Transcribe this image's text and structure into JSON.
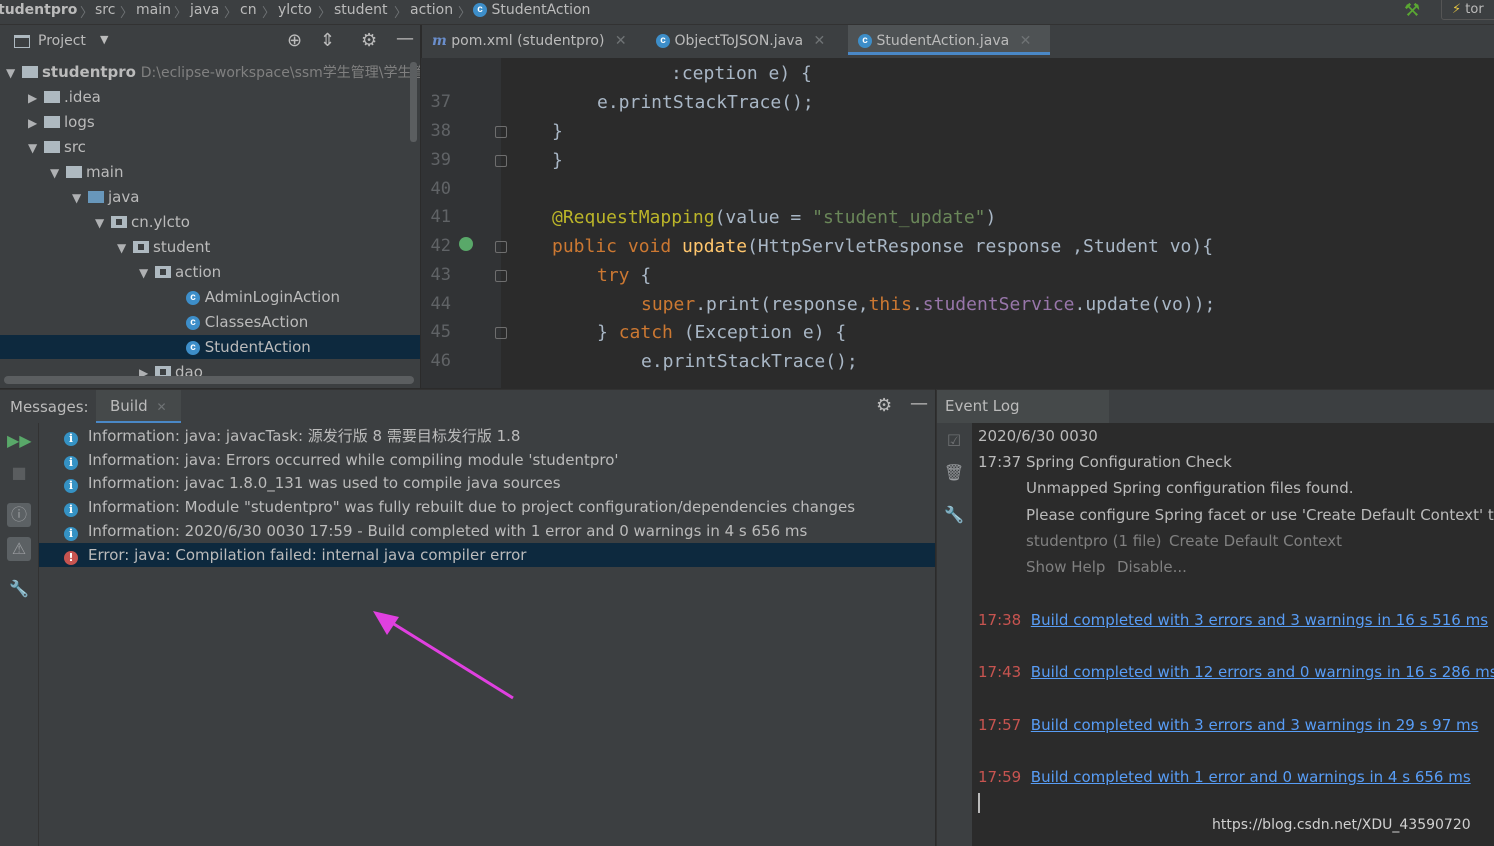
{
  "breadcrumb": {
    "items": [
      "tudentpro",
      "src",
      "main",
      "java",
      "cn",
      "ylcto",
      "student",
      "action"
    ],
    "current": "StudentAction",
    "run_config": "tor"
  },
  "project_panel": {
    "title": "Project",
    "root": {
      "name": "studentpro",
      "path": "D:\\eclipse-workspace\\ssm学生管理\\学生管理系统学生模块开发\\studentpro"
    },
    "nodes": [
      ".idea",
      "logs",
      "src",
      "main",
      "java",
      "cn.ylcto",
      "student",
      "action",
      "AdminLoginAction",
      "ClassesAction",
      "StudentAction",
      "dao"
    ]
  },
  "editor": {
    "tabs": [
      {
        "label": "pom.xml (studentpro)"
      },
      {
        "label": "ObjectToJSON.java"
      },
      {
        "label": "StudentAction.java",
        "active": true
      }
    ],
    "line_numbers": [
      "37",
      "38",
      "39",
      "40",
      "41",
      "42",
      "43",
      "44",
      "45",
      "46"
    ],
    "code": {
      "l36_tail": ":ception e) {",
      "l37": "e.printStackTrace();",
      "l38": "}",
      "l39": "}",
      "l41_anno": "@RequestMapping",
      "l41_open": "(",
      "l41_attr": "value",
      "l41_eq": " = ",
      "l41_str": "\"student_update\"",
      "l41_close": ")",
      "l42_kw": "public void ",
      "l42_fn": "update",
      "l42_rest": "(HttpServletResponse response ,Student vo){",
      "l43_kw": "try",
      "l43_rest": " {",
      "l44_kw1": "super",
      "l44_a": ".print(response,",
      "l44_kw2": "this",
      "l44_b": ".",
      "l44_field": "studentService",
      "l44_c": ".update(vo));",
      "l45_a": "} ",
      "l45_kw": "catch",
      "l45_b": " (Exception e) {",
      "l46": "e.printStackTrace();"
    }
  },
  "messages": {
    "label": "Messages:",
    "tab": "Build",
    "items": [
      {
        "type": "info",
        "text": "Information: java: javacTask: 源发行版 8 需要目标发行版 1.8"
      },
      {
        "type": "info",
        "text": "Information: java: Errors occurred while compiling module 'studentpro'"
      },
      {
        "type": "info",
        "text": "Information: javac 1.8.0_131 was used to compile java sources"
      },
      {
        "type": "info",
        "text": "Information: Module \"studentpro\" was fully rebuilt due to project configuration/dependencies changes"
      },
      {
        "type": "info",
        "text": "Information: 2020/6/30 0030 17:59 - Build completed with 1 error and 0 warnings in 4 s 656 ms"
      },
      {
        "type": "error",
        "text": "Error: java: Compilation failed: internal java compiler error"
      }
    ]
  },
  "event_log": {
    "title": "Event Log",
    "date": "2020/6/30 0030",
    "first": {
      "time": "17:37",
      "title": "Spring Configuration Check",
      "line1": "Unmapped Spring configuration files found.",
      "line2": "Please configure Spring facet or use 'Create Default Context' to a",
      "action1": "studentpro (1 file)",
      "action2": "Create Default Context",
      "action3": "Show Help",
      "action4": "Disable..."
    },
    "entries": [
      {
        "time": "17:38",
        "text": "Build completed with 3 errors and 3 warnings in 16 s 516 ms"
      },
      {
        "time": "17:43",
        "text": "Build completed with 12 errors and 0 warnings in 16 s 286 ms"
      },
      {
        "time": "17:57",
        "text": "Build completed with 3 errors and 3 warnings in 29 s 97 ms"
      },
      {
        "time": "17:59",
        "text": "Build completed with 1 error and 0 warnings in 4 s 656 ms"
      }
    ]
  },
  "watermark": "https://blog.csdn.net/XDU_43590720"
}
